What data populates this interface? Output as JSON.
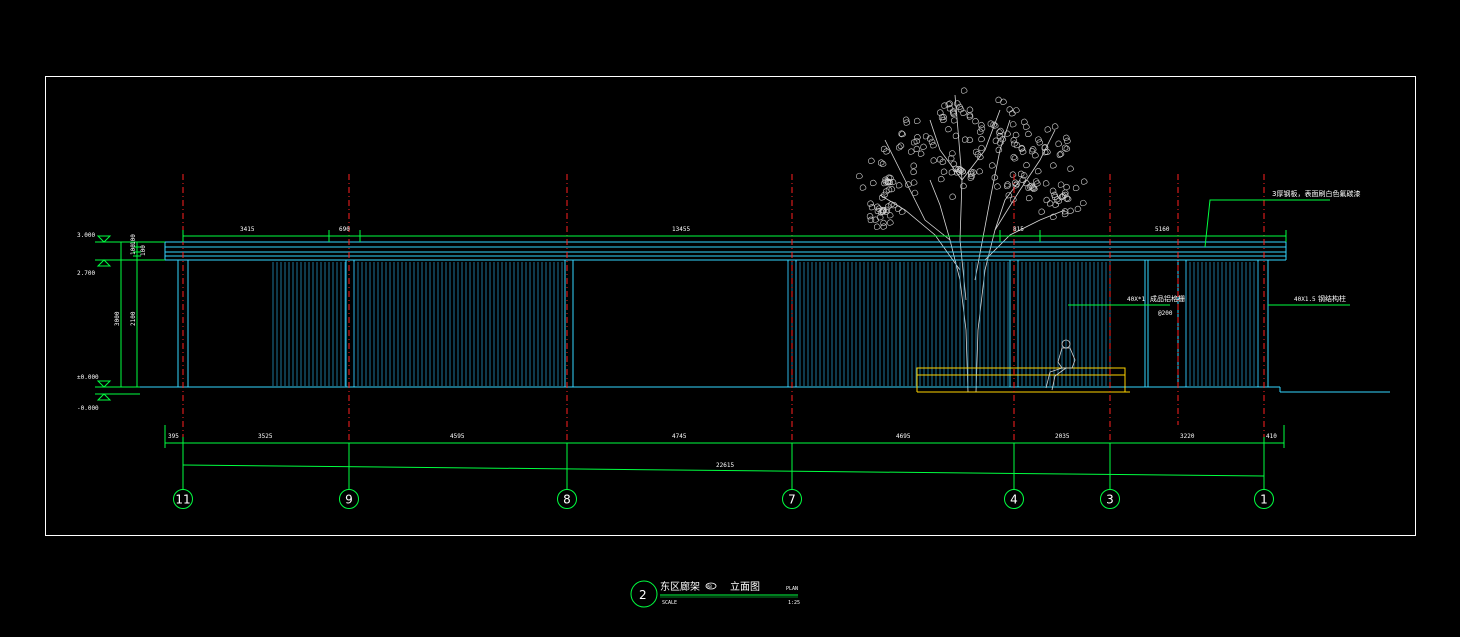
{
  "top_dimensions": [
    "3415",
    "690",
    "13455",
    "815",
    "5160"
  ],
  "bottom_dimensions": [
    "395",
    "3525",
    "4595",
    "4745",
    "4695",
    "2035",
    "3220",
    "410"
  ],
  "total_dimension": "22615",
  "levels": {
    "top": "3.000",
    "mid": "2.700",
    "ground": "±0.000",
    "below": "-0.000"
  },
  "vertical_dims": {
    "top_a": "100",
    "top_b": "100",
    "top_c": "100",
    "overall": "3000",
    "post": "2100"
  },
  "grid_axes": [
    "11",
    "9",
    "8",
    "7",
    "4",
    "3",
    "1"
  ],
  "annotations": {
    "roof_note": "3厚钢板，表面刷白色氟碳漆",
    "screen_note_code": "40X*1",
    "screen_note_text": "成品铝格栅",
    "screen_note_sub": "@200",
    "post_note_code": "40X1.5",
    "post_note_text": "钢结构柱"
  },
  "title": {
    "number": "2",
    "name": "东区廊架",
    "marker": "AB",
    "type": "立面图",
    "plan_label": "PLAN",
    "scale_label": "SCALE",
    "scale_value": "1:25"
  }
}
